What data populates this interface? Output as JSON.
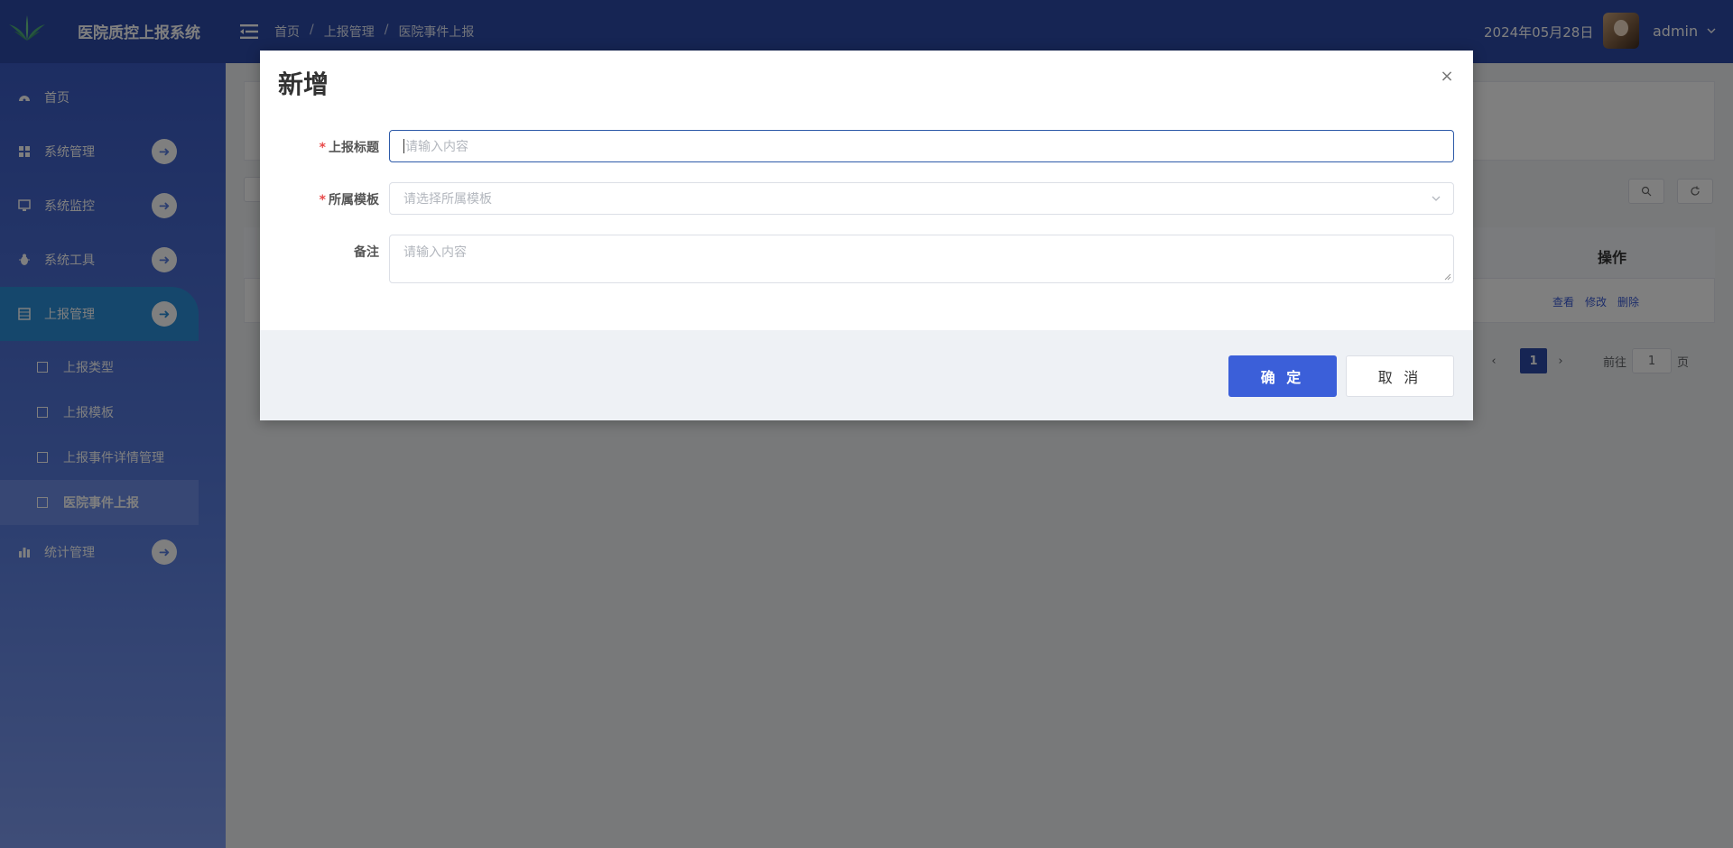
{
  "header": {
    "system_title": "医院质控上报系统",
    "breadcrumb": [
      "首页",
      "上报管理",
      "医院事件上报"
    ],
    "breadcrumb_sep": "/",
    "date": "2024年05月28日",
    "username": "admin",
    "brand_color": "#2d4aa8"
  },
  "sidebar": {
    "items": [
      {
        "label": "首页",
        "icon": "dashboard-icon"
      },
      {
        "label": "系统管理",
        "icon": "grid-icon"
      },
      {
        "label": "系统监控",
        "icon": "monitor-icon"
      },
      {
        "label": "系统工具",
        "icon": "bug-icon"
      },
      {
        "label": "上报管理",
        "icon": "table-icon"
      },
      {
        "label": "统计管理",
        "icon": "bar-chart-icon"
      }
    ],
    "sub_items": [
      "上报类型",
      "上报模板",
      "上报事件详情管理",
      "医院事件上报"
    ],
    "arrow_glyph": "➜"
  },
  "main": {
    "op_header": "操作",
    "row_actions": [
      "查看",
      "修改",
      "删除"
    ],
    "pager": {
      "prev": "‹",
      "current": "1",
      "next": "›",
      "goto_prefix": "前往",
      "goto_value": "1",
      "goto_suffix": "页"
    }
  },
  "dialog": {
    "title": "新增",
    "close_glyph": "×",
    "fields": {
      "title_label": "上报标题",
      "title_placeholder": "请输入内容",
      "template_label": "所属模板",
      "template_placeholder": "请选择所属模板",
      "remark_label": "备注",
      "remark_placeholder": "请输入内容",
      "required_mark": "*"
    },
    "confirm_label": "确 定",
    "cancel_label": "取 消"
  }
}
